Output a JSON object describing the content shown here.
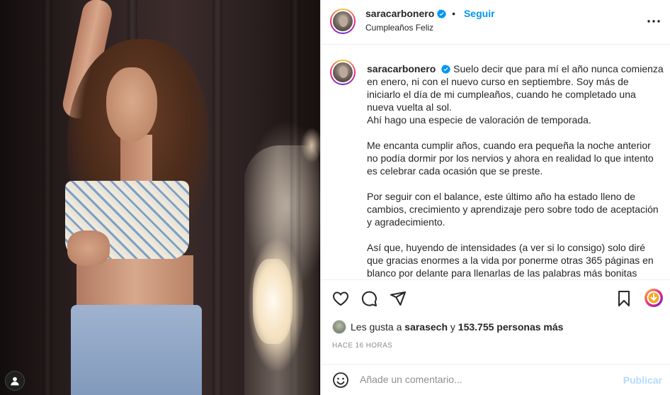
{
  "post": {
    "username": "saracarbonero",
    "follow_label": "Seguir",
    "subtitle": "Cumpleaños Feliz",
    "more_icon": "more-horizontal-icon"
  },
  "caption": {
    "username": "saracarbonero",
    "paragraphs": [
      "Suelo decir que para mí el año nunca comienza en enero, ni con el nuevo curso en septiembre. Soy más de iniciarlo el día de mi cumpleaños, cuando he completado una nueva vuelta al sol.\nAhí hago una especie de valoración de temporada.",
      "Me encanta cumplir años, cuando era pequeña la noche anterior no podía dormir por los nervios y ahora en realidad lo que intento es celebrar cada ocasión que se preste.",
      "Por seguir con el balance, este último año ha estado lleno de cambios, crecimiento y aprendizaje pero sobre todo de aceptación y agradecimiento.",
      "Así que, huyendo de intensidades (a ver si lo consigo) solo diré que gracias enormes a la vida por ponerme otras 365 páginas en blanco por delante para llenarlas de las palabras más bonitas posibles. Me"
    ]
  },
  "likes": {
    "prefix": "Les gusta a",
    "user": "sarasech",
    "connector": "y",
    "count": "153.755 personas más"
  },
  "time": "HACE 16 HORAS",
  "comment": {
    "placeholder": "Añade un comentario...",
    "publish_label": "Publicar"
  },
  "colors": {
    "accent": "#0095f6",
    "publish_disabled": "#b3dbff",
    "muted": "#8e8e8e",
    "text": "#262626"
  }
}
